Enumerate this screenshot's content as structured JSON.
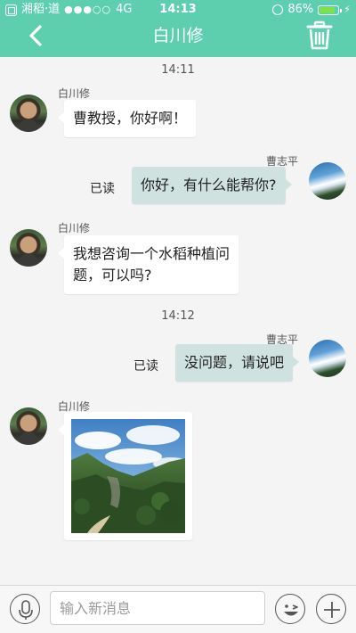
{
  "status_bar": {
    "carrier": "湘稻·道",
    "signal": "●●●○○",
    "network": "4G",
    "time": "14:13",
    "battery_percent": "86%",
    "battery_level": 0.86
  },
  "nav": {
    "title": "白川修"
  },
  "chat": {
    "timestamps": [
      "14:11",
      "14:12"
    ],
    "messages": [
      {
        "sender": "白川修",
        "side": "left",
        "text": "曹教授，你好啊！"
      },
      {
        "sender": "曹志平",
        "side": "right",
        "text": "你好，有什么能帮你?",
        "read": "已读"
      },
      {
        "sender": "白川修",
        "side": "left",
        "text_line1": "我想咨询一个水稻种植问",
        "text_line2": "题，可以吗?"
      },
      {
        "sender": "曹志平",
        "side": "right",
        "text": "没问题，请说吧",
        "read": "已读"
      },
      {
        "sender": "白川修",
        "side": "left",
        "type": "image",
        "image": "mountain-landscape-photo"
      }
    ]
  },
  "input_bar": {
    "placeholder": "输入新消息",
    "voice_icon": "microphone-icon",
    "emoji_icon": "wink-face-icon",
    "add_icon": "plus-icon"
  },
  "colors": {
    "header": "#5ecfae",
    "bubble_left": "#ffffff",
    "bubble_right": "#cfe2df",
    "background": "#f4f4f4"
  }
}
